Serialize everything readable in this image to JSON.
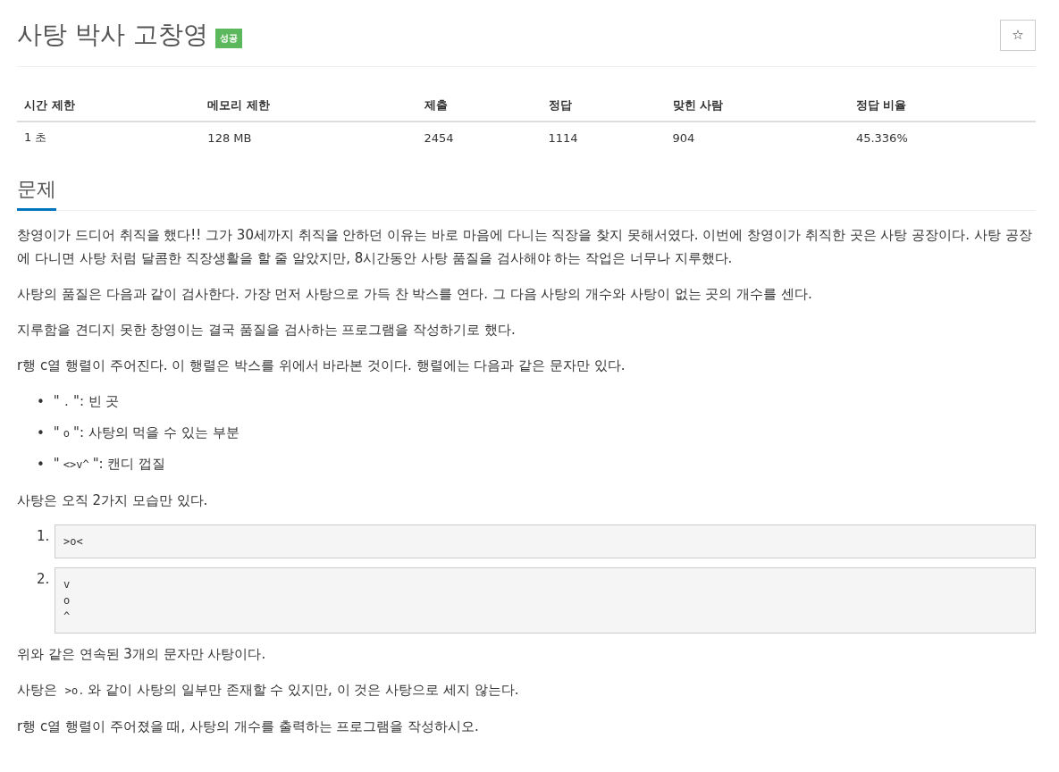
{
  "title": "사탕 박사 고창영",
  "badge": "성공",
  "star_button": "☆",
  "stats": {
    "columns": [
      "시간 제한",
      "메모리 제한",
      "제출",
      "정답",
      "맞힌 사람",
      "정답 비율"
    ],
    "rows": [
      [
        "1 초",
        "128 MB",
        "2454",
        "1114",
        "904",
        "45.336%"
      ]
    ]
  },
  "section_title": "문제",
  "blocks": [
    {
      "kind": "paragraph",
      "text": "창영이가 드디어 취직을 했다!! 그가 30세까지 취직을 안하던 이유는 바로 마음에 다니는 직장을 찾지 못해서였다. 이번에 창영이가 취직한 곳은 사탕 공장이다. 사탕 공장에 다니면 사탕 처럼 달콤한 직장생활을 할 줄 알았지만, 8시간동안 사탕 품질을 검사해야 하는 작업은 너무나 지루했다."
    },
    {
      "kind": "paragraph",
      "text": "사탕의 품질은 다음과 같이 검사한다. 가장 먼저 사탕으로 가득 찬 박스를 연다. 그 다음 사탕의 개수와 사탕이 없는 곳의 개수를 센다."
    },
    {
      "kind": "paragraph",
      "text": "지루함을 견디지 못한 창영이는 결국 품질을 검사하는 프로그램을 작성하기로 했다."
    },
    {
      "kind": "paragraph",
      "text": "r행 c열 행렬이 주어진다. 이 행렬은 박스를 위에서 바라본 것이다. 행렬에는 다음과 같은 문자만 있다."
    },
    {
      "kind": "bullets",
      "items": [
        {
          "bullet": "•",
          "prefix": "\"",
          "code": ".",
          "suffix": "\": 빈 곳"
        },
        {
          "bullet": "•",
          "prefix": "\"",
          "code": "o",
          "suffix": "\": 사탕의 먹을 수 있는 부분"
        },
        {
          "bullet": "•",
          "prefix": "\"",
          "code": "<>v^",
          "suffix": "\": 캔디 껍질"
        }
      ]
    },
    {
      "kind": "paragraph",
      "text": "사탕은 오직 2가지 모습만 있다."
    },
    {
      "kind": "numbered_code",
      "items": [
        {
          "number": "1.",
          "lines": [
            ">o<"
          ]
        },
        {
          "number": "2.",
          "lines": [
            "v",
            "o",
            "^"
          ]
        }
      ]
    },
    {
      "kind": "paragraph",
      "text": "위와 같은 연속된 3개의 문자만 사탕이다."
    },
    {
      "kind": "code_paragraph",
      "before": "사탕은",
      "code": ">o.",
      "after": "와 같이 사탕의 일부만 존재할 수 있지만, 이 것은 사탕으로 세지 않는다."
    },
    {
      "kind": "paragraph",
      "text": "r행 c열 행렬이 주어졌을 때, 사탕의 개수를 출력하는 프로그램을 작성하시오."
    }
  ]
}
